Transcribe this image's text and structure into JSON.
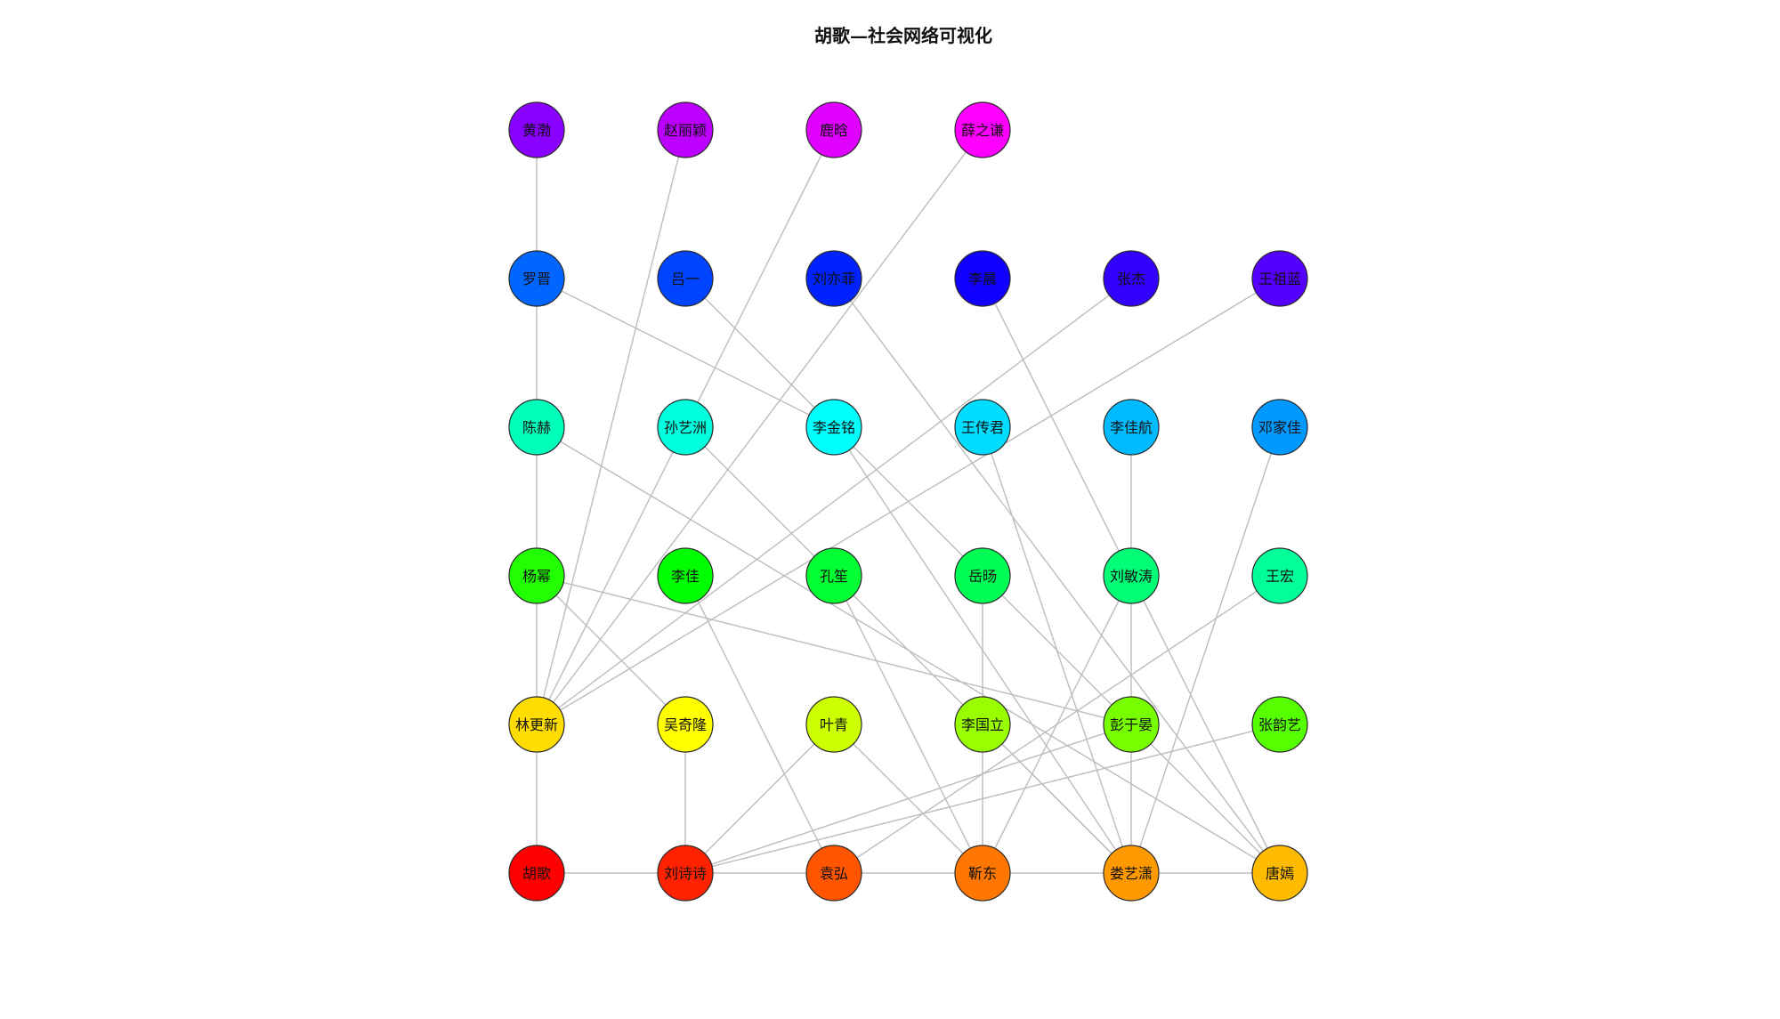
{
  "diagram": {
    "title": "胡歌—社会网络可视化",
    "nodes": [
      {
        "id": "huangbo",
        "label": "黄渤",
        "color": "#8a00ff"
      },
      {
        "id": "zhaoliying",
        "label": "赵丽颖",
        "color": "#bb00ff"
      },
      {
        "id": "luhan",
        "label": "鹿晗",
        "color": "#e000ff"
      },
      {
        "id": "xuezhiqian",
        "label": "薛之谦",
        "color": "#ff00ff"
      },
      {
        "id": "luojin",
        "label": "罗晋",
        "color": "#0066ff"
      },
      {
        "id": "lvyi",
        "label": "吕一",
        "color": "#0044ff"
      },
      {
        "id": "liuyifei",
        "label": "刘亦菲",
        "color": "#0022ff"
      },
      {
        "id": "lichen",
        "label": "李晨",
        "color": "#1100ff"
      },
      {
        "id": "zhangjie",
        "label": "张杰",
        "color": "#3300ff"
      },
      {
        "id": "wangzulan",
        "label": "王祖蓝",
        "color": "#5500ff"
      },
      {
        "id": "chenhe",
        "label": "陈赫",
        "color": "#00ffbb"
      },
      {
        "id": "sunyizhou",
        "label": "孙艺洲",
        "color": "#00ffdd"
      },
      {
        "id": "lijinming",
        "label": "李金铭",
        "color": "#00ffff"
      },
      {
        "id": "wangchuanjun",
        "label": "王传君",
        "color": "#00ddff"
      },
      {
        "id": "lijiahang",
        "label": "李佳航",
        "color": "#00bbff"
      },
      {
        "id": "dengjiajia",
        "label": "邓家佳",
        "color": "#0099ff"
      },
      {
        "id": "yangmi",
        "label": "杨幂",
        "color": "#22ff00"
      },
      {
        "id": "lijia",
        "label": "李佳",
        "color": "#00ff00"
      },
      {
        "id": "kongsheng",
        "label": "孔笙",
        "color": "#00ff33"
      },
      {
        "id": "yueyang",
        "label": "岳旸",
        "color": "#00ff55"
      },
      {
        "id": "liumintao",
        "label": "刘敏涛",
        "color": "#00ff77"
      },
      {
        "id": "wanghong",
        "label": "王宏",
        "color": "#00ff99"
      },
      {
        "id": "lingengxin",
        "label": "林更新",
        "color": "#ffdd00"
      },
      {
        "id": "wuqilong",
        "label": "吴奇隆",
        "color": "#ffff00"
      },
      {
        "id": "yeqing",
        "label": "叶青",
        "color": "#ccff00"
      },
      {
        "id": "liguoli",
        "label": "李国立",
        "color": "#99ff00"
      },
      {
        "id": "pengyuyan",
        "label": "彭于晏",
        "color": "#77ff00"
      },
      {
        "id": "zhangyunyi",
        "label": "张韵艺",
        "color": "#55ff00"
      },
      {
        "id": "huge",
        "label": "胡歌",
        "color": "#ff0000"
      },
      {
        "id": "liushishi",
        "label": "刘诗诗",
        "color": "#ff2200"
      },
      {
        "id": "yuanhong",
        "label": "袁弘",
        "color": "#ff5500"
      },
      {
        "id": "jindong",
        "label": "靳东",
        "color": "#ff7700"
      },
      {
        "id": "louyixiao",
        "label": "娄艺潇",
        "color": "#ff9900"
      },
      {
        "id": "tangyan",
        "label": "唐嫣",
        "color": "#ffbb00"
      }
    ],
    "edges": [
      [
        "huangbo",
        "luojin"
      ],
      [
        "luojin",
        "chenhe"
      ],
      [
        "chenhe",
        "yangmi"
      ],
      [
        "yangmi",
        "lingengxin"
      ],
      [
        "lingengxin",
        "huge"
      ],
      [
        "huge",
        "liushishi"
      ],
      [
        "liushishi",
        "yuanhong"
      ],
      [
        "yuanhong",
        "jindong"
      ],
      [
        "jindong",
        "louyixiao"
      ],
      [
        "louyixiao",
        "tangyan"
      ],
      [
        "lingengxin",
        "zhaoliying"
      ],
      [
        "lingengxin",
        "sunyizhou"
      ],
      [
        "lingengxin",
        "xuezhiqian"
      ],
      [
        "lingengxin",
        "zhangjie"
      ],
      [
        "lingengxin",
        "wangzulan"
      ],
      [
        "sunyizhou",
        "luhan"
      ],
      [
        "sunyizhou",
        "louyixiao"
      ],
      [
        "luojin",
        "lijinming"
      ],
      [
        "lvyi",
        "yueyang"
      ],
      [
        "liuyifei",
        "tangyan"
      ],
      [
        "lichen",
        "liumintao"
      ],
      [
        "chenhe",
        "tangyan"
      ],
      [
        "lijinming",
        "louyixiao"
      ],
      [
        "wangchuanjun",
        "louyixiao"
      ],
      [
        "lijiahang",
        "liumintao"
      ],
      [
        "dengjiajia",
        "louyixiao"
      ],
      [
        "yangmi",
        "wuqilong"
      ],
      [
        "yangmi",
        "pengyuyan"
      ],
      [
        "lijia",
        "yuanhong"
      ],
      [
        "kongsheng",
        "jindong"
      ],
      [
        "yueyang",
        "liguoli"
      ],
      [
        "yueyang",
        "tangyan"
      ],
      [
        "liumintao",
        "pengyuyan"
      ],
      [
        "liumintao",
        "jindong"
      ],
      [
        "liumintao",
        "tangyan"
      ],
      [
        "wanghong",
        "yuanhong"
      ],
      [
        "wuqilong",
        "liushishi"
      ],
      [
        "yeqing",
        "liushishi"
      ],
      [
        "yeqing",
        "jindong"
      ],
      [
        "liguoli",
        "jindong"
      ],
      [
        "liguoli",
        "louyixiao"
      ],
      [
        "pengyuyan",
        "liushishi"
      ],
      [
        "pengyuyan",
        "louyixiao"
      ],
      [
        "zhangyunyi",
        "liushishi"
      ]
    ]
  }
}
